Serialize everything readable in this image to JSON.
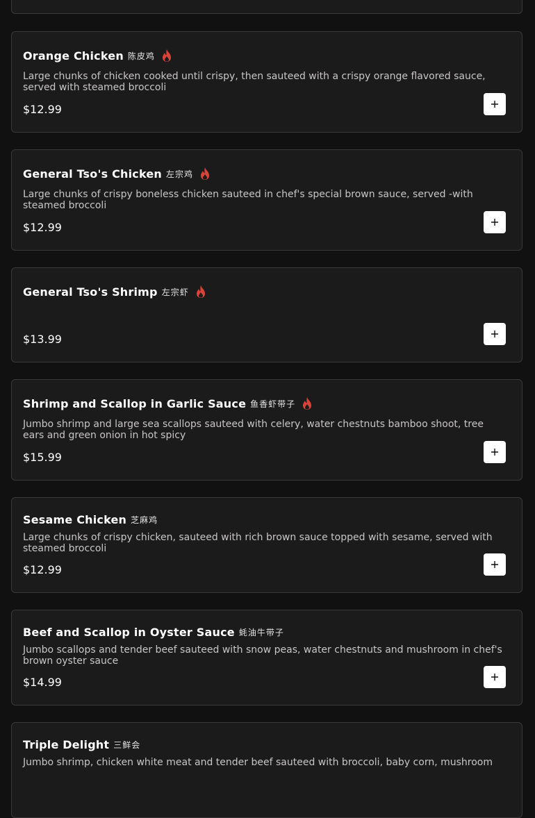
{
  "items": [
    {
      "name": "Orange Chicken",
      "chinese": "陈皮鸡",
      "spicy": true,
      "description": "Large chunks of chicken cooked until crispy, then sauteed with a crispy orange flavored sauce, served with steamed broccoli",
      "price": "$12.99"
    },
    {
      "name": "General Tso's Chicken",
      "chinese": "左宗鸡",
      "spicy": true,
      "description": "Large chunks of crispy boneless chicken sauteed in chef's special brown sauce, served -with steamed broccoli",
      "price": "$12.99"
    },
    {
      "name": "General Tso's Shrimp",
      "chinese": "左宗虾",
      "spicy": true,
      "description": "",
      "price": "$13.99"
    },
    {
      "name": "Shrimp and Scallop in Garlic Sauce",
      "chinese": "鱼香虾带子",
      "spicy": true,
      "description": "Jumbo shrimp and large sea scallops sauteed with celery, water chestnuts bamboo shoot, tree ears and green onion in hot spicy",
      "price": "$15.99"
    },
    {
      "name": "Sesame Chicken",
      "chinese": "芝麻鸡",
      "spicy": false,
      "description": "Large chunks of crispy chicken, sauteed with rich brown sauce topped with sesame, served with steamed broccoli",
      "price": "$12.99"
    },
    {
      "name": "Beef and Scallop in Oyster Sauce",
      "chinese": "蚝油牛带子",
      "spicy": false,
      "description": "Jumbo scallops and tender beef sauteed with snow peas, water chestnuts and mushroom in chef's brown oyster sauce",
      "price": "$14.99"
    },
    {
      "name": "Triple Delight",
      "chinese": "三鲜会",
      "spicy": false,
      "description": "Jumbo shrimp, chicken white meat and tender beef sauteed with broccoli, baby corn, mushroom",
      "price": ""
    }
  ],
  "icons": {
    "spicy": "flame-icon",
    "add": "plus-icon"
  },
  "colors": {
    "background": "#111111",
    "card": "#1c1b1c",
    "card_border": "#3a3839",
    "spicy": "#d9433a",
    "add_button": "#ffffff"
  }
}
